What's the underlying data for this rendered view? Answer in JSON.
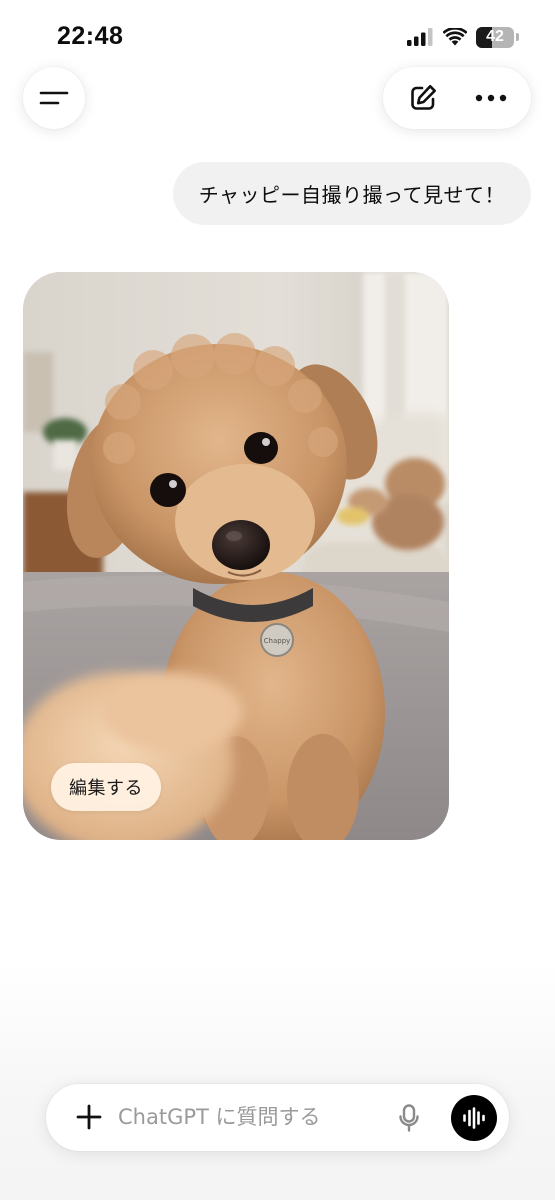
{
  "status_bar": {
    "time": "22:48",
    "battery_level": "42",
    "battery_fraction": 0.42,
    "icons": [
      "cellular-signal-icon",
      "wifi-icon",
      "battery-icon"
    ]
  },
  "top_bar": {
    "menu_icon": "sidebar-menu-icon",
    "new_chat_icon": "compose-icon",
    "more_icon": "ellipsis-icon"
  },
  "conversation": {
    "user_message": "チャッピー自撮り撮って見せて！",
    "image": {
      "subject": "dog-selfie",
      "tag_text": "Chappy",
      "edit_button_label": "編集する"
    }
  },
  "composer": {
    "placeholder": "ChatGPT に質問する",
    "value": "",
    "add_icon": "plus-icon",
    "mic_icon": "microphone-icon",
    "voice_icon": "voice-mode-icon"
  },
  "colors": {
    "background": "#ffffff",
    "bubble": "#f1f1f1",
    "voice_button": "#000000",
    "placeholder": "#9a9a9a"
  }
}
